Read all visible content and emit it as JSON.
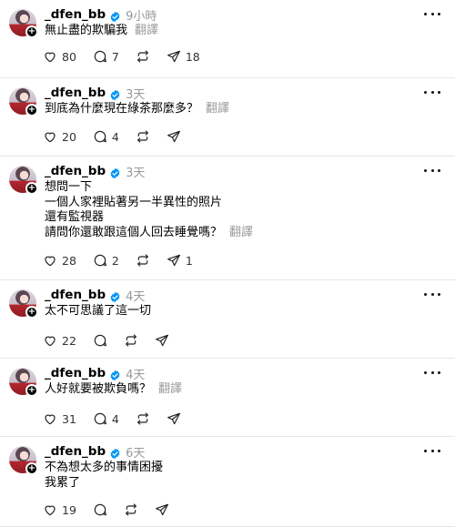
{
  "posts": [
    {
      "username": "_dfen_bb",
      "time": "9小時",
      "lines": [
        "無止盡的欺騙我"
      ],
      "translate": "翻譯",
      "likes": "80",
      "replies": "7",
      "reposts": "",
      "shares": "18"
    },
    {
      "username": "_dfen_bb",
      "time": "3天",
      "lines": [
        "到底為什麼現在綠茶那麼多？"
      ],
      "translate": "翻譯",
      "likes": "20",
      "replies": "4",
      "reposts": "",
      "shares": ""
    },
    {
      "username": "_dfen_bb",
      "time": "3天",
      "lines": [
        "想問一下",
        "一個人家裡貼著另一半異性的照片",
        "還有監視器",
        "請問你還敢跟這個人回去睡覺嗎？"
      ],
      "translate": "翻譯",
      "likes": "28",
      "replies": "2",
      "reposts": "",
      "shares": "1"
    },
    {
      "username": "_dfen_bb",
      "time": "4天",
      "lines": [
        "太不可思議了這一切"
      ],
      "translate": "",
      "likes": "22",
      "replies": "",
      "reposts": "",
      "shares": ""
    },
    {
      "username": "_dfen_bb",
      "time": "4天",
      "lines": [
        "人好就要被欺負嗎？"
      ],
      "translate": "翻譯",
      "likes": "31",
      "replies": "4",
      "reposts": "",
      "shares": ""
    },
    {
      "username": "_dfen_bb",
      "time": "6天",
      "lines": [
        "不為想太多的事情困擾",
        "我累了"
      ],
      "translate": "",
      "likes": "19",
      "replies": "",
      "reposts": "",
      "shares": ""
    }
  ],
  "icons": {
    "verified": "verified-badge-icon",
    "more": "more-options-icon",
    "like": "heart-icon",
    "reply": "comment-icon",
    "repost": "repost-icon",
    "share": "send-icon"
  },
  "colors": {
    "verified": "#0095f6",
    "muted": "#999999",
    "divider": "#e6e6e6"
  }
}
